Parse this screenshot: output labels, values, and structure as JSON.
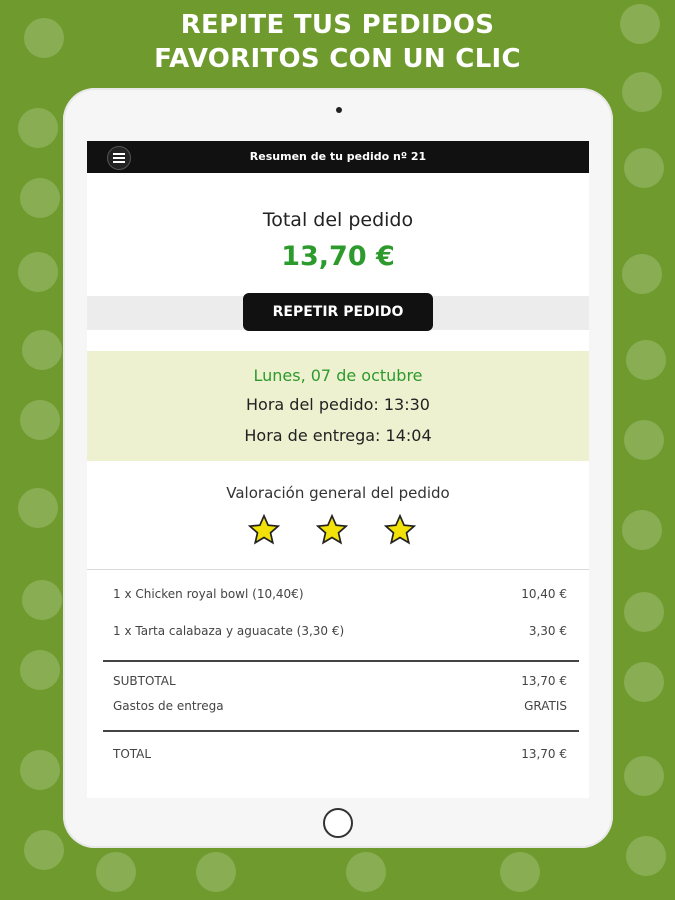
{
  "banner": {
    "line1": "REPITE TUS PEDIDOS",
    "line2": "FAVORITOS CON UN CLIC"
  },
  "header": {
    "title": "Resumen de tu pedido nº 21",
    "menu_icon": "hamburger-menu-icon"
  },
  "order": {
    "total_label": "Total del pedido",
    "total_amount": "13,70 €",
    "repeat_button": "REPETIR PEDIDO",
    "date": "Lunes, 07 de octubre",
    "order_time": "Hora del pedido: 13:30",
    "delivery_time": "Hora de entrega: 14:04"
  },
  "rating": {
    "label": "Valoración general del pedido",
    "stars": 3,
    "max_stars": 3
  },
  "items": [
    {
      "description": "1 x  Chicken royal bowl (10,40€)",
      "price": "10,40 €"
    },
    {
      "description": "1 x Tarta calabaza y aguacate (3,30 €)",
      "price": "3,30 €"
    }
  ],
  "summary": {
    "subtotal_label": "SUBTOTAL",
    "subtotal_value": "13,70 €",
    "delivery_label": "Gastos de entrega",
    "delivery_value": "GRATIS",
    "total_label": "TOTAL",
    "total_value": "13,70 €"
  },
  "colors": {
    "background": "#6f9b2e",
    "accent_green": "#2d9a2d",
    "date_block": "#edf1cf",
    "star": "#f2e20a"
  }
}
